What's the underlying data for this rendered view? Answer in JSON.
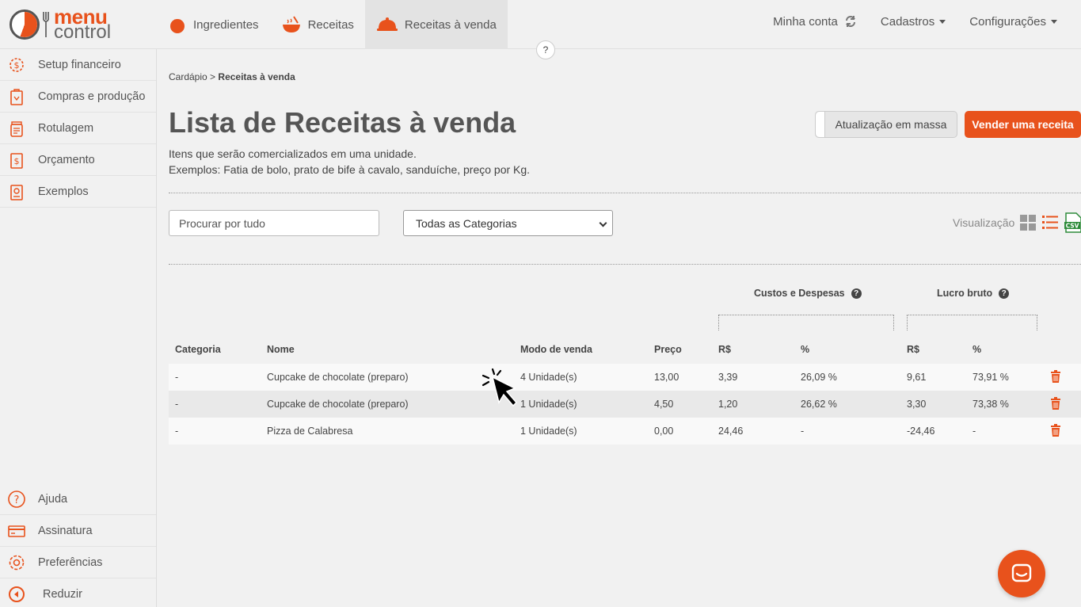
{
  "brand": {
    "line1": "menu",
    "line2": "control",
    "accent": "#e8521c"
  },
  "topnav": [
    {
      "label": "Ingredientes",
      "icon": "tomato-icon",
      "active": false
    },
    {
      "label": "Receitas",
      "icon": "pot-icon",
      "active": false
    },
    {
      "label": "Receitas à venda",
      "icon": "cloche-icon",
      "active": true
    }
  ],
  "help_label": "?",
  "topright": {
    "account": "Minha conta",
    "cadastros": "Cadastros",
    "config": "Configurações"
  },
  "sidebar": {
    "items": [
      {
        "label": "Setup financeiro",
        "icon": "dollar-gear-icon"
      },
      {
        "label": "Compras e produção",
        "icon": "shopping-bag-icon"
      },
      {
        "label": "Rotulagem",
        "icon": "jar-label-icon"
      },
      {
        "label": "Orçamento",
        "icon": "budget-doc-icon"
      },
      {
        "label": "Exemplos",
        "icon": "recipe-book-icon"
      }
    ],
    "bottom": [
      {
        "label": "Ajuda",
        "icon": "help-icon"
      },
      {
        "label": "Assinatura",
        "icon": "card-icon"
      },
      {
        "label": "Preferências",
        "icon": "settings-icon"
      },
      {
        "label": "Reduzir",
        "icon": "collapse-icon"
      }
    ]
  },
  "breadcrumb": {
    "parent": "Cardápio",
    "sep": ">",
    "current": "Receitas à venda"
  },
  "page": {
    "title": "Lista de Receitas à venda",
    "desc1": "Itens que serão comercializados em uma unidade.",
    "desc2": "Exemplos: Fatia de bolo, prato de bife à cavalo, sanduíche, preço por Kg."
  },
  "actions": {
    "mass_update": "Atualização em massa",
    "sell": "Vender uma receita"
  },
  "filters": {
    "search_placeholder": "Procurar por tudo",
    "category_selected": "Todas as Categorias"
  },
  "view": {
    "label": "Visualização"
  },
  "table": {
    "group_costs": "Custos e Despesas",
    "group_profit": "Lucro bruto",
    "headers": {
      "categoria": "Categoria",
      "nome": "Nome",
      "modo": "Modo de venda",
      "preco": "Preço",
      "custo_rs": "R$",
      "custo_pct": "%",
      "lucro_rs": "R$",
      "lucro_pct": "%"
    },
    "rows": [
      {
        "categoria": "-",
        "nome": "Cupcake de chocolate (preparo)",
        "modo": "4 Unidade(s)",
        "preco": "13,00",
        "custo_rs": "3,39",
        "custo_pct": "26,09 %",
        "lucro_rs": "9,61",
        "lucro_pct": "73,91 %"
      },
      {
        "categoria": "-",
        "nome": "Cupcake de chocolate (preparo)",
        "modo": "1 Unidade(s)",
        "preco": "4,50",
        "custo_rs": "1,20",
        "custo_pct": "26,62 %",
        "lucro_rs": "3,30",
        "lucro_pct": "73,38 %"
      },
      {
        "categoria": "-",
        "nome": "Pizza de Calabresa",
        "modo": "1 Unidade(s)",
        "preco": "0,00",
        "custo_rs": "24,46",
        "custo_pct": "-",
        "lucro_rs": "-24,46",
        "lucro_pct": "-"
      }
    ]
  }
}
